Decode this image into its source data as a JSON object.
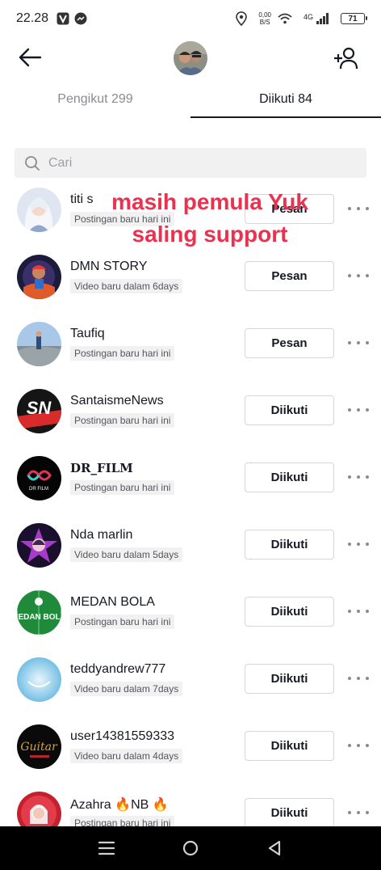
{
  "status_bar": {
    "time": "22.28",
    "net_speed_value": "0,00",
    "net_speed_unit": "B/S",
    "network": "4G",
    "battery": "71",
    "icons": [
      "v-app-icon",
      "messenger-icon",
      "location-icon",
      "wifi-icon",
      "signal-icon",
      "battery-icon"
    ]
  },
  "header": {
    "back_icon": "arrow-left-icon",
    "add_icon": "add-user-icon"
  },
  "tabs": [
    {
      "label": "Pengikut 299",
      "active": false
    },
    {
      "label": "Diikuti 84",
      "active": true
    }
  ],
  "search": {
    "placeholder": "Cari",
    "value": ""
  },
  "overlay_text": {
    "line1": "masih pemula Yuk",
    "line2": "saling support"
  },
  "users": [
    {
      "name": "titi s",
      "subtitle": "Postingan baru hari ini",
      "button": "Pesan"
    },
    {
      "name": "DMN STORY",
      "subtitle": "Video baru dalam 6days",
      "button": "Pesan"
    },
    {
      "name": "Taufiq",
      "subtitle": "Postingan baru hari ini",
      "button": "Pesan"
    },
    {
      "name": "SantaismeNews",
      "subtitle": "Postingan baru hari ini",
      "button": "Diikuti"
    },
    {
      "name": "DR_FILM",
      "subtitle": "Postingan baru hari ini",
      "button": "Diikuti"
    },
    {
      "name": "Nda  marlin",
      "subtitle": "Video baru dalam 5days",
      "button": "Diikuti"
    },
    {
      "name": "MEDAN BOLA",
      "subtitle": "Postingan baru hari ini",
      "button": "Diikuti"
    },
    {
      "name": "teddyandrew777",
      "subtitle": "Video baru dalam 7days",
      "button": "Diikuti"
    },
    {
      "name": "user14381559333",
      "subtitle": "Video baru dalam 4days",
      "button": "Diikuti"
    },
    {
      "name": "Azahra 🔥NB 🔥",
      "subtitle": "Postingan baru hari ini",
      "button": "Diikuti"
    }
  ],
  "avatar_art": {
    "santaisme": "SN",
    "drfilm": "DR FILM",
    "medanbola": "MEDAN BOLA",
    "guitar": "Guitar"
  },
  "nav": [
    "menu-icon",
    "home-circle-icon",
    "back-triangle-icon"
  ]
}
